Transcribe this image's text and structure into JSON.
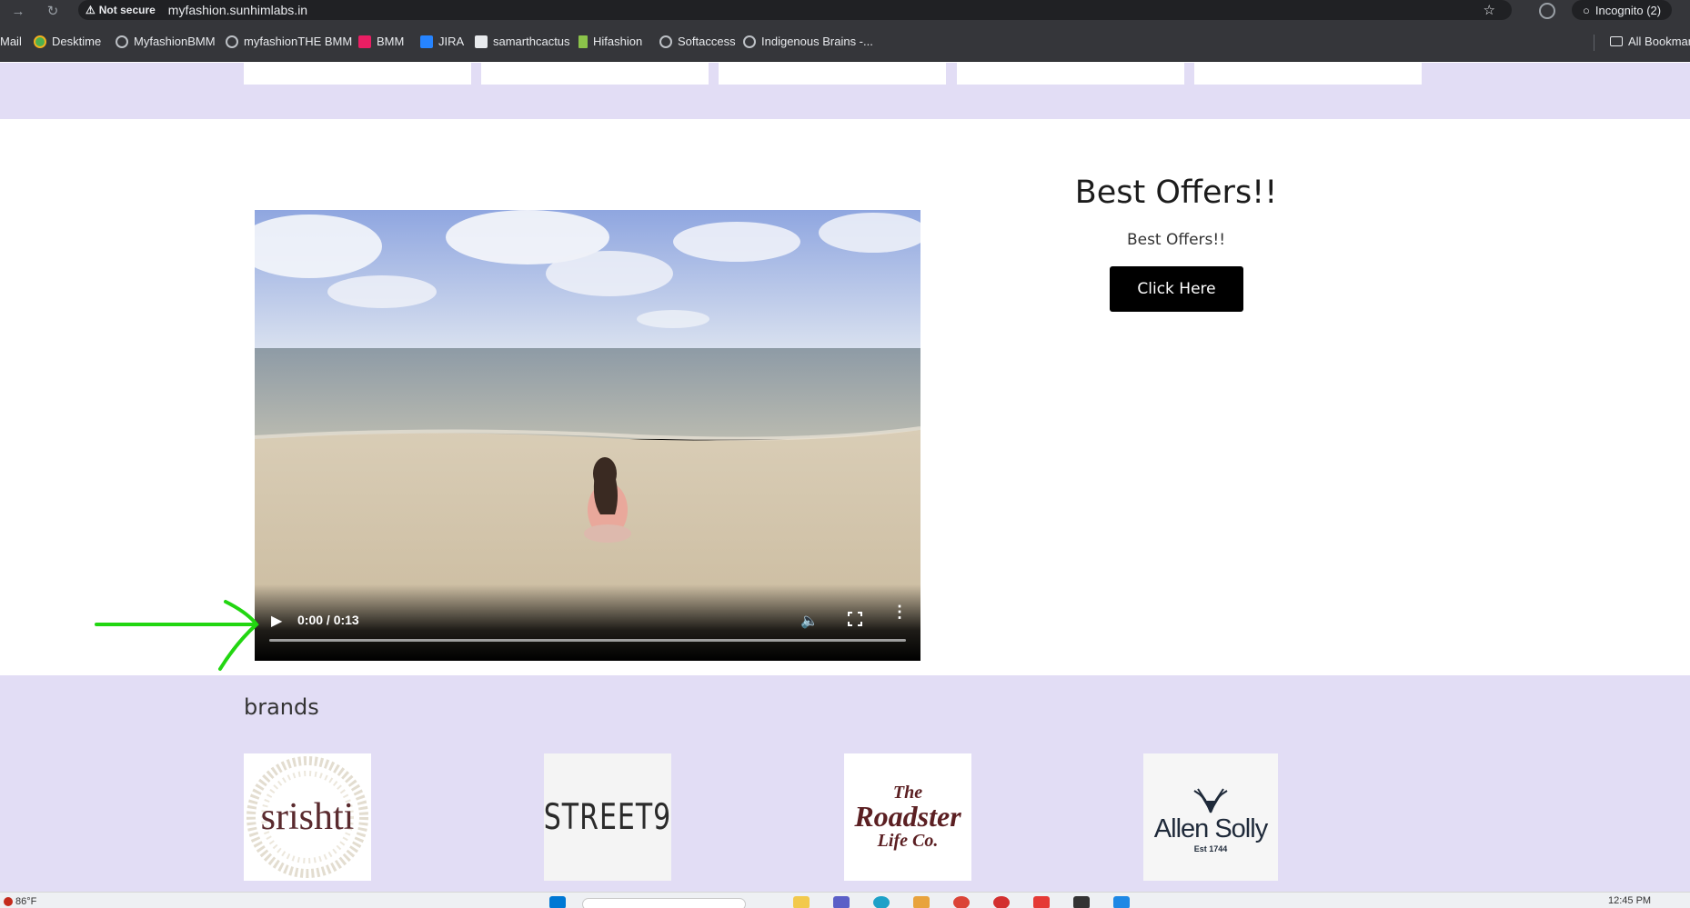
{
  "browser": {
    "security_label": "Not secure",
    "url": "myfashion.sunhimlabs.in",
    "incognito_label": "Incognito (2)",
    "bookmarks": [
      {
        "label": "Mail"
      },
      {
        "label": "Desktime"
      },
      {
        "label": "MyfashionBMM"
      },
      {
        "label": "myfashionTHE BMM"
      },
      {
        "label": "BMM"
      },
      {
        "label": "JIRA"
      },
      {
        "label": "samarthcactus"
      },
      {
        "label": "Hifashion"
      },
      {
        "label": "Softaccess"
      },
      {
        "label": "Indigenous Brains -..."
      }
    ],
    "all_bookmarks_label": "All Bookmar"
  },
  "video": {
    "time": "0:00 / 0:13"
  },
  "offers": {
    "title": "Best Offers!!",
    "subtitle": "Best Offers!!",
    "button_label": "Click Here"
  },
  "brands": {
    "heading": "brands",
    "items": [
      {
        "name": "srishti"
      },
      {
        "name": "STREET9"
      },
      {
        "line1": "The",
        "line2": "Roadster",
        "line3": "Life Co."
      },
      {
        "name": "Allen Solly",
        "tagline": "Est 1744"
      }
    ]
  },
  "taskbar": {
    "temperature": "86°F",
    "clock": "12:45 PM"
  },
  "colors": {
    "band": "#e2ddf5",
    "annotation_arrow": "#22d611",
    "button_bg": "#000000"
  }
}
